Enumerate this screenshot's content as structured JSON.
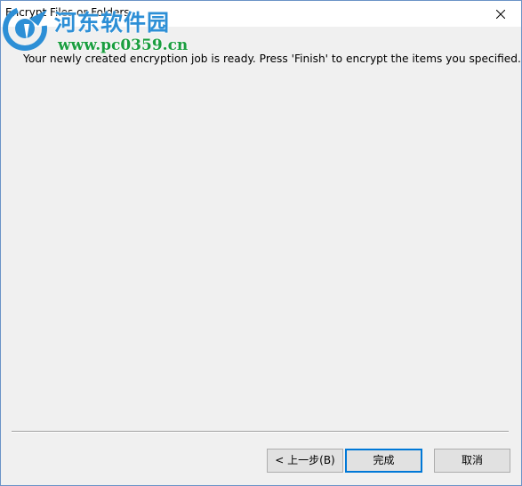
{
  "window": {
    "title": "Encrypt Files or Folders"
  },
  "watermark": {
    "site_name": "河东软件园",
    "url": "www.pc0359.cn"
  },
  "content": {
    "message": "Your newly created encryption job is ready. Press 'Finish' to encrypt the items you specified."
  },
  "buttons": {
    "back_label": "< 上一步(B)",
    "finish_label": "完成",
    "cancel_label": "取消"
  },
  "colors": {
    "accent": "#0078d7",
    "dialog_background": "#f0f0f0",
    "watermark_blue": "#2d8fd6",
    "watermark_green": "#1a9e3f"
  }
}
